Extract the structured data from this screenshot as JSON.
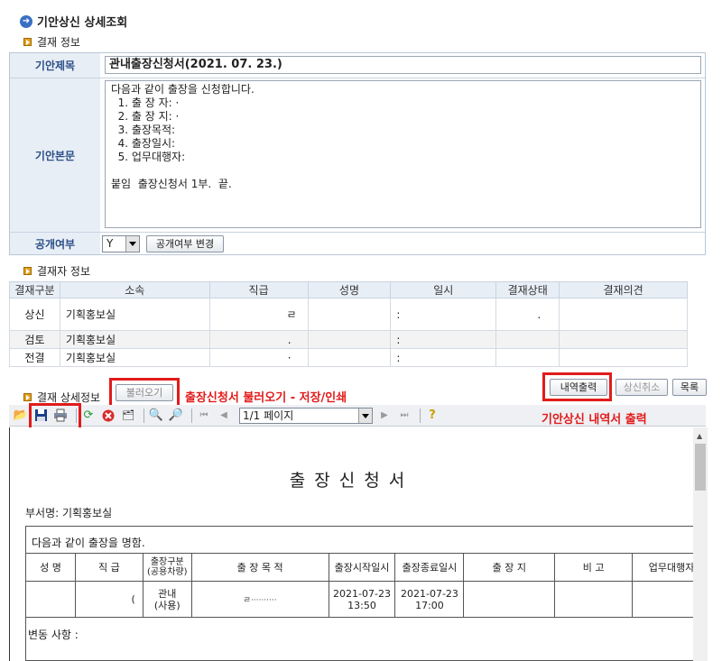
{
  "page_title": "기안상신 상세조회",
  "approval_info": {
    "section_title": "결재 정보",
    "title_label": "기안제목",
    "title_value": "관내출장신청서(2021. 07. 23.)",
    "body_label": "기안본문",
    "body_value": "다음과 같이 출장을 신청합니다.\n  1. 출 장 자: ·\n  2. 출 장 지: ·\n  3. 출장목적:\n  4. 출장일시:\n  5. 업무대행자:\n\n붙임  출장신청서 1부.  끝.",
    "public_label": "공개여부",
    "public_value": "Y",
    "public_change_button": "공개여부 변경"
  },
  "approver_info": {
    "section_title": "결재자 정보",
    "columns": [
      "결재구분",
      "소속",
      "직급",
      "성명",
      "일시",
      "결재상태",
      "결재의견"
    ],
    "rows": [
      {
        "type": "상신",
        "dept": "기획홍보실",
        "rank": "ㄹ",
        "name": "",
        "date": ":",
        "status": ".",
        "opinion": ""
      },
      {
        "type": "검토",
        "dept": "기획홍보실",
        "rank": ".",
        "name": "",
        "date": ":",
        "status": "",
        "opinion": ""
      },
      {
        "type": "전결",
        "dept": "기획홍보실",
        "rank": "·",
        "name": "",
        "date": ":",
        "status": "",
        "opinion": ""
      }
    ]
  },
  "detail": {
    "section_title": "결재 상세정보",
    "load_button": "불러오기",
    "load_annotation": "출장신청서 불러오기 - 저장/인쇄",
    "print_button": "내역출력",
    "cancel_button": "상신취소",
    "list_button": "목록",
    "print_annotation": "기안상신 내역서 출력",
    "page_select": "1/1 페이지"
  },
  "report": {
    "title": "출장신청서",
    "dept_line": "부서명: 기획홍보실",
    "intro": "다음과 같이 출장을 명함.",
    "columns": [
      "성  명",
      "직  급",
      "출장구분\n(공용차량)",
      "출 장 목 적",
      "출장시작일시",
      "출장종료일시",
      "출 장 지",
      "비  고",
      "업무대행자"
    ],
    "row": {
      "name": "",
      "rank": "(",
      "kind": "관내\n(사용)",
      "purpose": "ㄹ··········",
      "start": "2021-07-23\n13:50",
      "end": "2021-07-23\n17:00",
      "place": "",
      "note": "",
      "deputy": ""
    },
    "changes_label": "변동 사항 :"
  },
  "colors": {
    "annotation_red": "#e21b1b",
    "label_bg": "#e8eef6",
    "label_text": "#2b4f86"
  }
}
